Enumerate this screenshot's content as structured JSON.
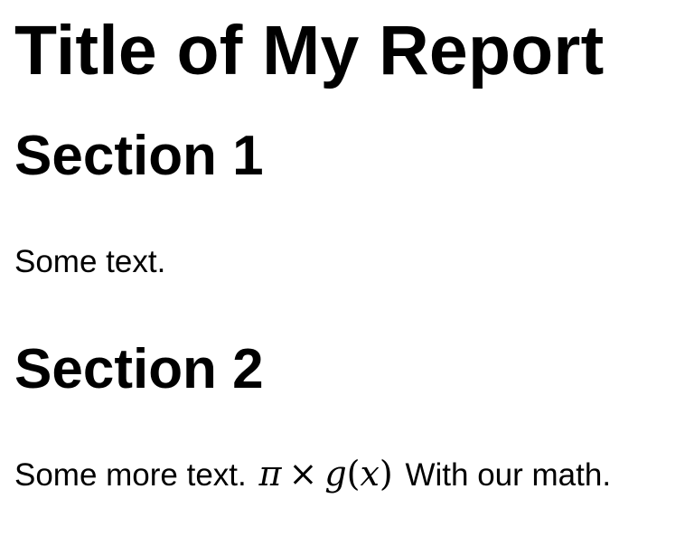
{
  "document": {
    "title": "Title of My Report",
    "sections": [
      {
        "heading": "Section 1",
        "body": "Some text."
      },
      {
        "heading": "Section 2",
        "body_before_math": "Some more text.",
        "math": {
          "pi": "π",
          "times": "×",
          "func": "g",
          "open_paren": "(",
          "arg": "x",
          "close_paren": ")"
        },
        "body_after_math": "With our math."
      }
    ]
  }
}
